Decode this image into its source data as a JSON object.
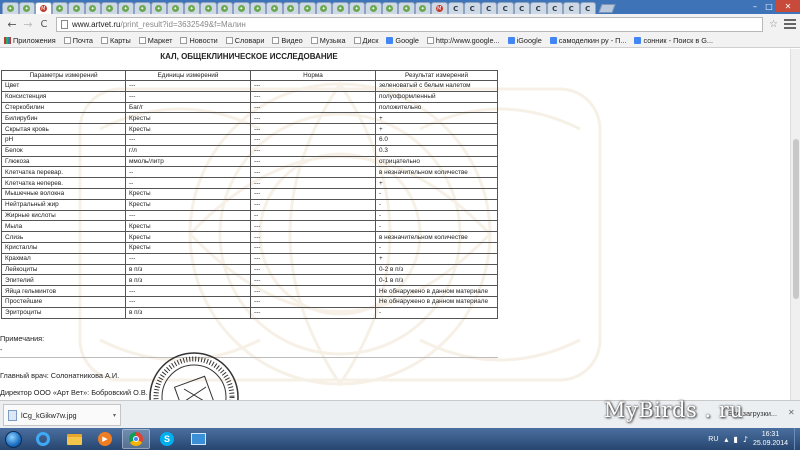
{
  "browser": {
    "tabs": [
      {
        "icon": "bird-favicon",
        "glyph": "✦"
      },
      {
        "icon": "bird-favicon",
        "glyph": "✦"
      },
      {
        "icon": "mail-favicon",
        "glyph": "M",
        "active": true
      },
      {
        "icon": "bird-favicon",
        "glyph": "✦"
      },
      {
        "icon": "bird-favicon",
        "glyph": "✦"
      },
      {
        "icon": "bird-favicon",
        "glyph": "✦"
      },
      {
        "icon": "bird-favicon",
        "glyph": "✦"
      },
      {
        "icon": "bird-favicon",
        "glyph": "✦"
      },
      {
        "icon": "bird-favicon",
        "glyph": "✦"
      },
      {
        "icon": "bird-favicon",
        "glyph": "✦"
      },
      {
        "icon": "bird-favicon",
        "glyph": "✦"
      },
      {
        "icon": "bird-favicon",
        "glyph": "✦"
      },
      {
        "icon": "bird-favicon",
        "glyph": "✦"
      },
      {
        "icon": "bird-favicon",
        "glyph": "✦"
      },
      {
        "icon": "bird-favicon",
        "glyph": "✦"
      },
      {
        "icon": "bird-favicon",
        "glyph": "✦"
      },
      {
        "icon": "bird-favicon",
        "glyph": "✦"
      },
      {
        "icon": "bird-favicon",
        "glyph": "✦"
      },
      {
        "icon": "bird-favicon",
        "glyph": "✦"
      },
      {
        "icon": "bird-favicon",
        "glyph": "✦"
      },
      {
        "icon": "bird-favicon",
        "glyph": "✦"
      },
      {
        "icon": "bird-favicon",
        "glyph": "✦"
      },
      {
        "icon": "bird-favicon",
        "glyph": "✦"
      },
      {
        "icon": "bird-favicon",
        "glyph": "✦"
      },
      {
        "icon": "bird-favicon",
        "glyph": "✦"
      },
      {
        "icon": "bird-favicon",
        "glyph": "✦"
      },
      {
        "icon": "mail-favicon",
        "glyph": "M"
      },
      {
        "icon": "c-favicon",
        "glyph": "C"
      },
      {
        "icon": "c-favicon",
        "glyph": "C"
      },
      {
        "icon": "c-favicon",
        "glyph": "C"
      },
      {
        "icon": "c-favicon",
        "glyph": "C"
      },
      {
        "icon": "c-favicon",
        "glyph": "C"
      },
      {
        "icon": "c-favicon",
        "glyph": "C"
      },
      {
        "icon": "c-favicon",
        "glyph": "C"
      },
      {
        "icon": "c-favicon",
        "glyph": "C"
      },
      {
        "icon": "c-favicon",
        "glyph": "C"
      }
    ],
    "back_glyph": "←",
    "forward_glyph": "→",
    "reload_glyph": "C",
    "url_host": "www.artvet.ru",
    "url_path": "/print_result?id=3632549&f=Малин",
    "star_glyph": "☆",
    "close_glyph": "✕",
    "min_glyph": "–",
    "max_glyph": "□"
  },
  "bookmarks": [
    {
      "label": "Приложения",
      "icon": "apps-grid-icon"
    },
    {
      "label": "Почта",
      "icon": "folder-icon"
    },
    {
      "label": "Карты",
      "icon": "folder-icon"
    },
    {
      "label": "Маркет",
      "icon": "folder-icon"
    },
    {
      "label": "Новости",
      "icon": "folder-icon"
    },
    {
      "label": "Словари",
      "icon": "folder-icon"
    },
    {
      "label": "Видео",
      "icon": "folder-icon"
    },
    {
      "label": "Музыка",
      "icon": "folder-icon"
    },
    {
      "label": "Диск",
      "icon": "folder-icon"
    },
    {
      "label": "Google",
      "icon": "google-icon"
    },
    {
      "label": "http://www.google...",
      "icon": "page-icon"
    },
    {
      "label": "iGoogle",
      "icon": "google-icon"
    },
    {
      "label": "самоделкин ру - П...",
      "icon": "google-icon"
    },
    {
      "label": "сонник - Поиск в G...",
      "icon": "google-icon"
    }
  ],
  "report": {
    "title": "КАЛ, ОБЩЕКЛИНИЧЕСКОЕ ИССЛЕДОВАНИЕ",
    "columns": [
      "Параметры измерений",
      "Единицы измерений",
      "Норма",
      "Результат измерений"
    ],
    "rows": [
      [
        "Цвет",
        "---",
        "---",
        "зеленоватый с белым налетом"
      ],
      [
        "Консистенция",
        "---",
        "---",
        "полуоформленный"
      ],
      [
        "Стеркобилин",
        "Баг/г",
        "---",
        "положительно"
      ],
      [
        "Билирубин",
        "Кресты",
        "---",
        "+"
      ],
      [
        "Скрытая кровь",
        "Кресты",
        "---",
        "+"
      ],
      [
        "pH",
        "---",
        "---",
        "6.0"
      ],
      [
        "Белок",
        "г/л",
        "---",
        "0.3"
      ],
      [
        "Глюкоза",
        "ммоль/литр",
        "---",
        "отрицательно"
      ],
      [
        "Клетчатка перевар.",
        "--",
        "---",
        "в незначительном количестве"
      ],
      [
        "Клетчатка неперев.",
        "--",
        "---",
        "+"
      ],
      [
        "Мышечные волокна",
        "Кресты",
        "---",
        "-"
      ],
      [
        "Нейтральный жир",
        "Кресты",
        "---",
        "-"
      ],
      [
        "Жирные кислоты",
        "---",
        "--",
        "-"
      ],
      [
        "Мыла",
        "Кресты",
        "---",
        "-"
      ],
      [
        "Слизь",
        "Кресты",
        "---",
        "в незначительном количестве"
      ],
      [
        "Кристаллы",
        "Кресты",
        "---",
        "-"
      ],
      [
        "Крахмал",
        "---",
        "---",
        "+"
      ],
      [
        "Лейкоциты",
        "в п/з",
        "---",
        "0-2 в п/з"
      ],
      [
        "Эпителий",
        "в п/з",
        "---",
        "0-1 в п/з"
      ],
      [
        "Яйца гельминтов",
        "---",
        "---",
        "Не обнаружено в данном материале"
      ],
      [
        "Простейшие",
        "---",
        "---",
        "Не обнаружено в данном материале"
      ],
      [
        "Эритроциты",
        "в п/з",
        "---",
        "-"
      ]
    ],
    "notes_label": "Примечания:",
    "notes_value": "-",
    "doctor": "Главный врач: Солонатникова А.И.",
    "director": "Директор ООО «Арт Вет»: Бобровский О.В."
  },
  "downloads": {
    "file_name": "lCg_kGikw7w.jpg",
    "caret": "▾",
    "show_all": "Все загрузки...",
    "close_glyph": "✕"
  },
  "watermark_text": "MyBirds . ru",
  "taskbar": {
    "lang": "RU",
    "time": "16:31",
    "date": "25.09.2014"
  }
}
